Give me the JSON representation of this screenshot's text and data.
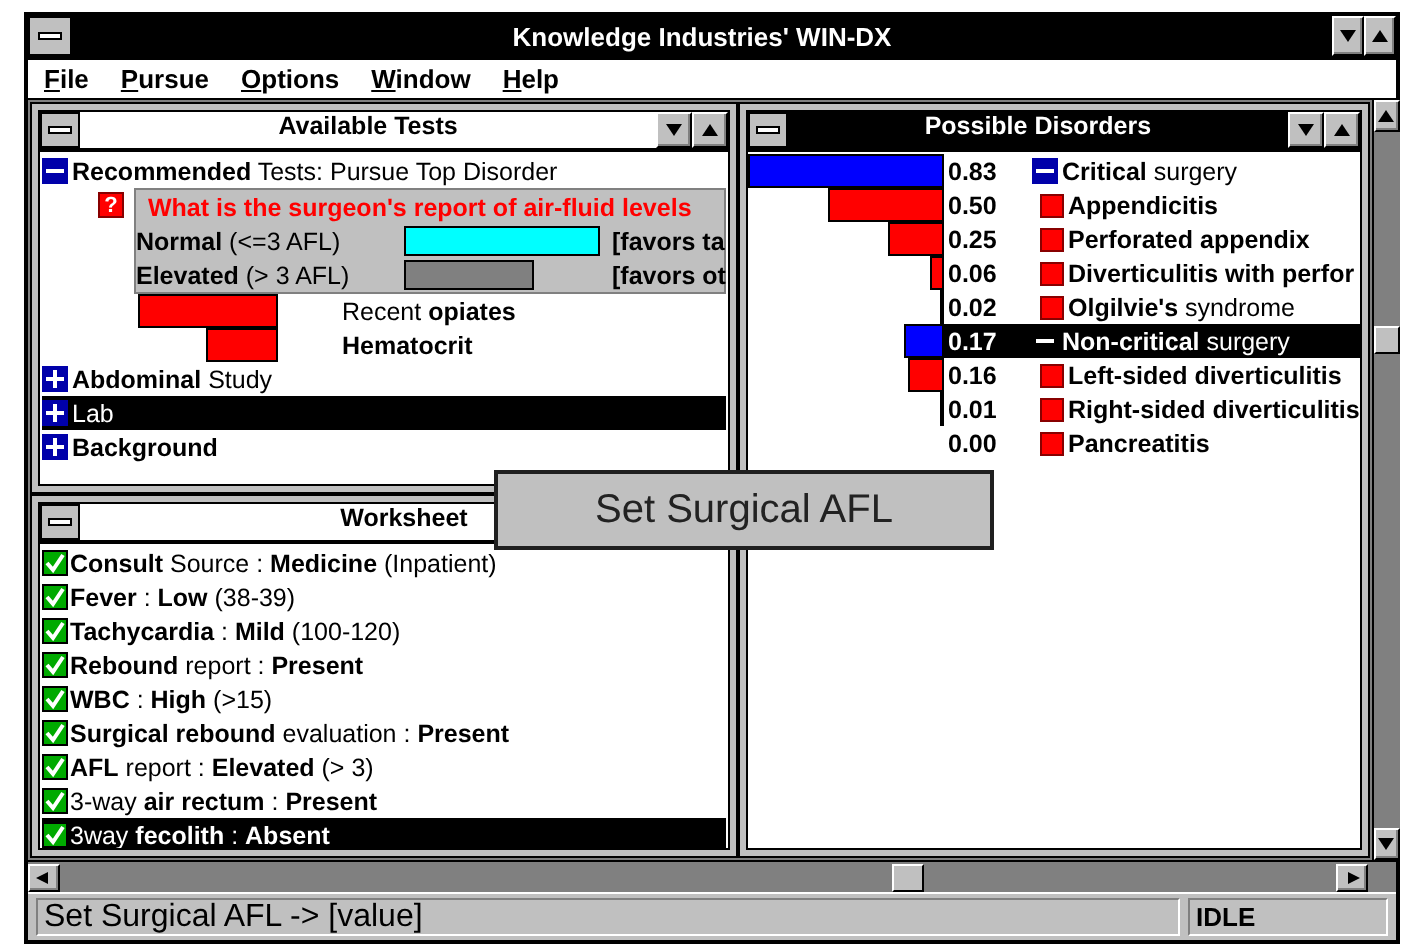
{
  "window": {
    "title": "Knowledge Industries' WIN-DX"
  },
  "menu": [
    "File",
    "Pursue",
    "Options",
    "Window",
    "Help"
  ],
  "available_tests": {
    "title": "Available Tests",
    "active": false,
    "items": [
      {
        "kind": "group",
        "text": "**Recommended** Tests: Pursue Top Disorder",
        "expanded": true,
        "selected": false,
        "children": [
          {
            "kind": "question",
            "badge": "?",
            "text": "What is the surgeon's report of air-fluid levels",
            "options": [
              {
                "text": "**Normal** (<=3 AFL)",
                "color": "#00ffff",
                "note": "[favors ta"
              },
              {
                "text": "**Elevated** (> 3 AFL)",
                "color": "#808080",
                "note": "[favors ot"
              }
            ]
          },
          {
            "kind": "evidence",
            "text": "Recent **opiates**"
          },
          {
            "kind": "evidence",
            "text": "**Hematocrit**"
          }
        ]
      },
      {
        "kind": "group",
        "text": "**Abdominal** Study",
        "expanded": false,
        "selected": false
      },
      {
        "kind": "group",
        "text": "Lab",
        "expanded": false,
        "selected": true
      },
      {
        "kind": "group",
        "text": "**Background**",
        "expanded": false,
        "selected": false
      }
    ]
  },
  "worksheet": {
    "title": "Worksheet",
    "active": false,
    "items": [
      {
        "text": "**Consult** Source : **Medicine** (Inpatient)",
        "checked": true,
        "selected": false
      },
      {
        "text": "**Fever** : **Low** (38-39)",
        "checked": true,
        "selected": false
      },
      {
        "text": "**Tachycardia** : **Mild** (100-120)",
        "checked": true,
        "selected": false
      },
      {
        "text": "**Rebound** report : **Present**",
        "checked": true,
        "selected": false
      },
      {
        "text": "**WBC**  : **High** (>15)",
        "checked": true,
        "selected": false
      },
      {
        "text": "**Surgical rebound** evaluation : **Present**",
        "checked": true,
        "selected": false
      },
      {
        "text": "**AFL** report : **Elevated** (> 3)",
        "checked": true,
        "selected": false
      },
      {
        "text": "3-way **air rectum** : **Present**",
        "checked": true,
        "selected": false
      },
      {
        "text": "3way **fecolith** : **Absent**",
        "checked": true,
        "selected": true
      }
    ]
  },
  "possible_disorders": {
    "title": "Possible Disorders",
    "active": true,
    "items": [
      {
        "kind": "category",
        "score": "0.83",
        "text": "**Critical** surgery",
        "level": 1.0,
        "expanded": true,
        "selected": false,
        "children": [
          {
            "kind": "disorder",
            "score": "0.50",
            "text": "**Appendicitis**",
            "level": 0.59,
            "selected": false
          },
          {
            "kind": "disorder",
            "score": "0.25",
            "text": "**Perforated appendix**",
            "level": 0.29,
            "selected": false
          },
          {
            "kind": "disorder",
            "score": "0.06",
            "text": "**Diverticulitis with perfor**",
            "level": 0.07,
            "selected": false
          },
          {
            "kind": "disorder",
            "score": "0.02",
            "text": "**Olgilvie's** syndrome",
            "level": 0.02,
            "selected": false
          }
        ]
      },
      {
        "kind": "category",
        "score": "0.17",
        "text": "**Non-critical** surgery",
        "level": 0.2,
        "expanded": true,
        "selected": true,
        "children": [
          {
            "kind": "disorder",
            "score": "0.16",
            "text": "**Left-sided diverticulitis**",
            "level": 0.18,
            "selected": false
          },
          {
            "kind": "disorder",
            "score": "0.01",
            "text": "**Right-sided diverticulitis**",
            "level": 0.01,
            "selected": false
          },
          {
            "kind": "disorder",
            "score": "0.00",
            "text": "**Pancreatitis**",
            "selected": false
          }
        ]
      }
    ]
  },
  "tooltip": "Set Surgical AFL",
  "status_bar": {
    "message": "Set Surgical AFL -> [value]",
    "state": "IDLE"
  }
}
